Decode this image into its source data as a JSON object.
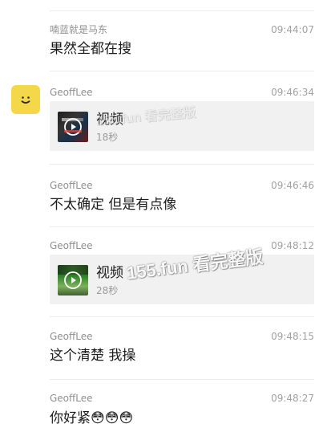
{
  "messages": [
    {
      "sender": "喃蓝就是马东",
      "time": "09:44:07",
      "text": "果然全都在搜"
    },
    {
      "sender": "GeoffLee",
      "time": "09:46:34",
      "video_label": "视频",
      "video_duration": "18秒"
    },
    {
      "sender": "GeoffLee",
      "time": "09:46:46",
      "text": "不太确定 但是有点像"
    },
    {
      "sender": "GeoffLee",
      "time": "09:48:12",
      "video_label": "视频",
      "video_duration": "28秒"
    },
    {
      "sender": "GeoffLee",
      "time": "09:48:15",
      "text": "这个清楚 我操"
    },
    {
      "sender": "GeoffLee",
      "time": "09:48:27",
      "text": "你好紧",
      "emojis": [
        "😳",
        "😳",
        "😳"
      ]
    }
  ],
  "watermarks": [
    "155.fun 看完整版",
    "155.fun 看完整版"
  ],
  "icons": {
    "avatar_face": "smile-face-icon",
    "play": "play-icon",
    "video_thumb_1": "video-thumbnail-dark-icon",
    "video_thumb_2": "video-thumbnail-green-icon"
  },
  "colors": {
    "avatar": "#f5d84a",
    "card": "#f1f1f1",
    "text": "#1c1c1c",
    "muted": "#8f8f8f",
    "divider": "#ececec"
  }
}
